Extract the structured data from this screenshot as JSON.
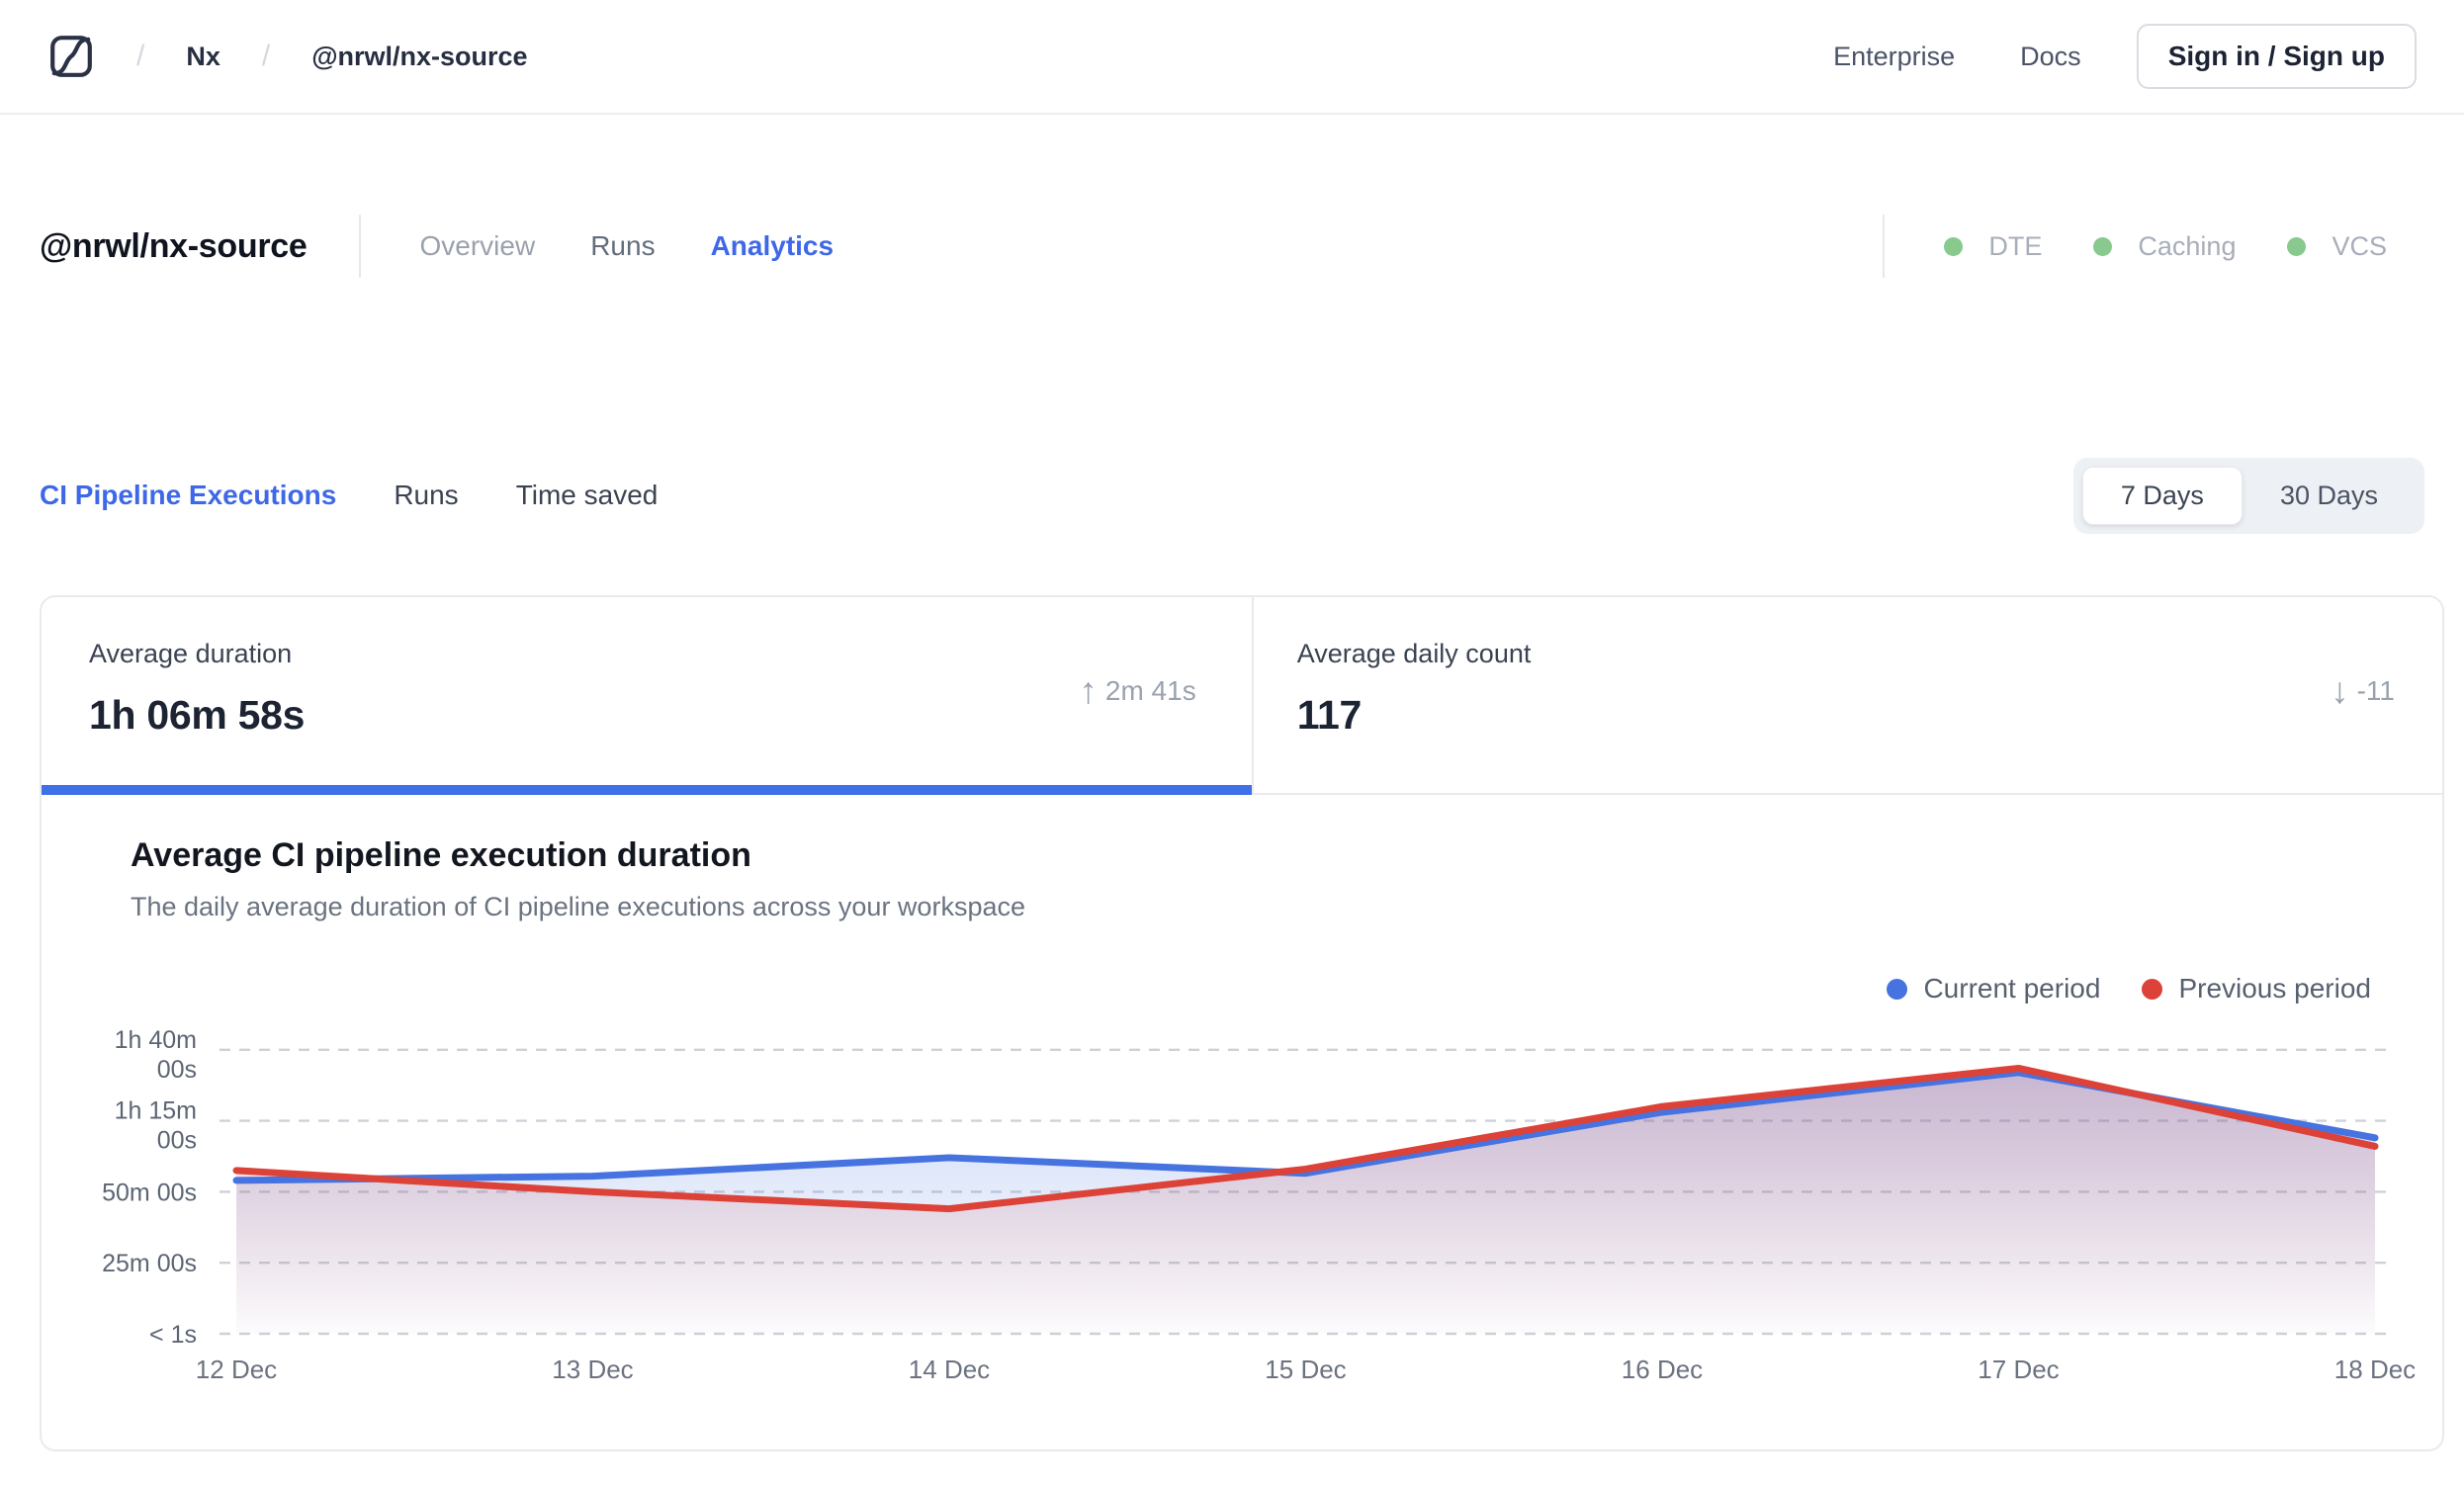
{
  "header": {
    "breadcrumb": {
      "separator": "/",
      "org": "Nx",
      "repo": "@nrwl/nx-source"
    },
    "nav": {
      "enterprise": "Enterprise",
      "docs": "Docs",
      "signin": "Sign in / Sign up"
    }
  },
  "workspace": {
    "title": "@nrwl/nx-source",
    "tabs": [
      {
        "label": "Overview",
        "active": false
      },
      {
        "label": "Runs",
        "active": false
      },
      {
        "label": "Analytics",
        "active": true
      }
    ],
    "status": [
      {
        "label": "DTE"
      },
      {
        "label": "Caching"
      },
      {
        "label": "VCS"
      }
    ]
  },
  "analytics_tabs": [
    {
      "label": "CI Pipeline Executions",
      "active": true
    },
    {
      "label": "Runs",
      "active": false
    },
    {
      "label": "Time saved",
      "active": false
    }
  ],
  "period_toggle": {
    "options": [
      "7 Days",
      "30 Days"
    ],
    "selected": "7 Days"
  },
  "stats": {
    "duration": {
      "label": "Average duration",
      "value": "1h 06m 58s",
      "delta": "2m 41s",
      "delta_direction": "up",
      "delta_arrow": "↑"
    },
    "daily_count": {
      "label": "Average daily count",
      "value": "117",
      "delta": "-11",
      "delta_direction": "down",
      "delta_arrow": "↓"
    }
  },
  "colors": {
    "accent_blue": "#3e68e8",
    "active_bar": "#4070e8",
    "status_green": "#89c98e",
    "grid": "#cdd2d9"
  },
  "chart_data": {
    "type": "area",
    "title": "Average CI pipeline execution duration",
    "subtitle": "The daily average duration of CI pipeline executions across your workspace",
    "categories": [
      "12 Dec",
      "13 Dec",
      "14 Dec",
      "15 Dec",
      "16 Dec",
      "17 Dec",
      "18 Dec"
    ],
    "unit": "minutes",
    "series": [
      {
        "name": "Current period",
        "color": "#4673e0",
        "values": [
          54,
          55.5,
          62,
          56.5,
          78,
          92,
          69
        ]
      },
      {
        "name": "Previous period",
        "color": "#dc4238",
        "values": [
          57.5,
          50,
          44,
          58,
          80,
          93.5,
          66
        ]
      }
    ],
    "ylim": [
      0,
      110
    ],
    "yticks": [
      {
        "value": 100,
        "label": [
          "1h 40m",
          "00s"
        ]
      },
      {
        "value": 75,
        "label": [
          "1h 15m",
          "00s"
        ]
      },
      {
        "value": 50,
        "label": [
          "50m 00s"
        ]
      },
      {
        "value": 25,
        "label": [
          "25m 00s"
        ]
      },
      {
        "value": 0,
        "label": [
          "< 1s"
        ]
      }
    ],
    "grid": "dashed-horizontal",
    "legend_position": "top-right"
  }
}
